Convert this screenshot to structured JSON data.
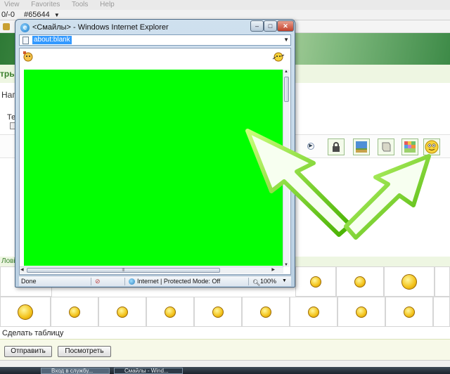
{
  "bg_browser": {
    "menu": [
      "View",
      "Favorites",
      "Tools",
      "Help"
    ],
    "tab_counter": "0/-0",
    "tab_id": "#65644",
    "page_title_fragment": "тры",
    "na_fragment": "Наг",
    "te_fragment": "Те",
    "lov_fragment": "Лові",
    "make_table_label": "Сделать таблицу",
    "send_button": "Отправить",
    "preview_button": "Посмотреть"
  },
  "popup": {
    "title": "<Смайлы> - Windows Internet Explorer",
    "address": "about:blank",
    "status_done": "Done",
    "zone": "Internet | Protected Mode: Off",
    "zoom": "100%",
    "content_bg": "#00ff00"
  },
  "taskbar": {
    "items": [
      "Вход в службу...",
      "Смайлы - Wind..."
    ]
  },
  "colors": {
    "arrow": "#6fd400",
    "banner": "#4f9a52",
    "selection": "#3399ff"
  },
  "icons": [
    "ie-icon",
    "smiley-icon",
    "lock-icon",
    "landscape-icon",
    "scroll-icon",
    "palette-icon",
    "big-smiley-icon"
  ]
}
